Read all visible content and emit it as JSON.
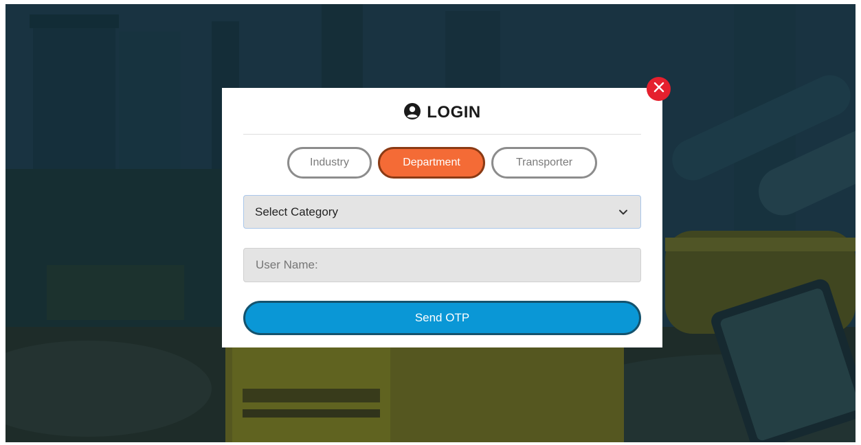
{
  "modal": {
    "title": "LOGIN",
    "title_icon": "user-circle-icon",
    "close_icon": "close-icon"
  },
  "tabs": [
    {
      "label": "Industry",
      "active": false
    },
    {
      "label": "Department",
      "active": true
    },
    {
      "label": "Transporter",
      "active": false
    }
  ],
  "category_select": {
    "value": "Select Category",
    "icon": "chevron-down-icon"
  },
  "username_input": {
    "placeholder": "User Name:"
  },
  "send_button": {
    "label": "Send OTP"
  },
  "colors": {
    "active_tab": "#f46b36",
    "primary_button": "#0a97d6",
    "close_button": "#e5202e"
  }
}
